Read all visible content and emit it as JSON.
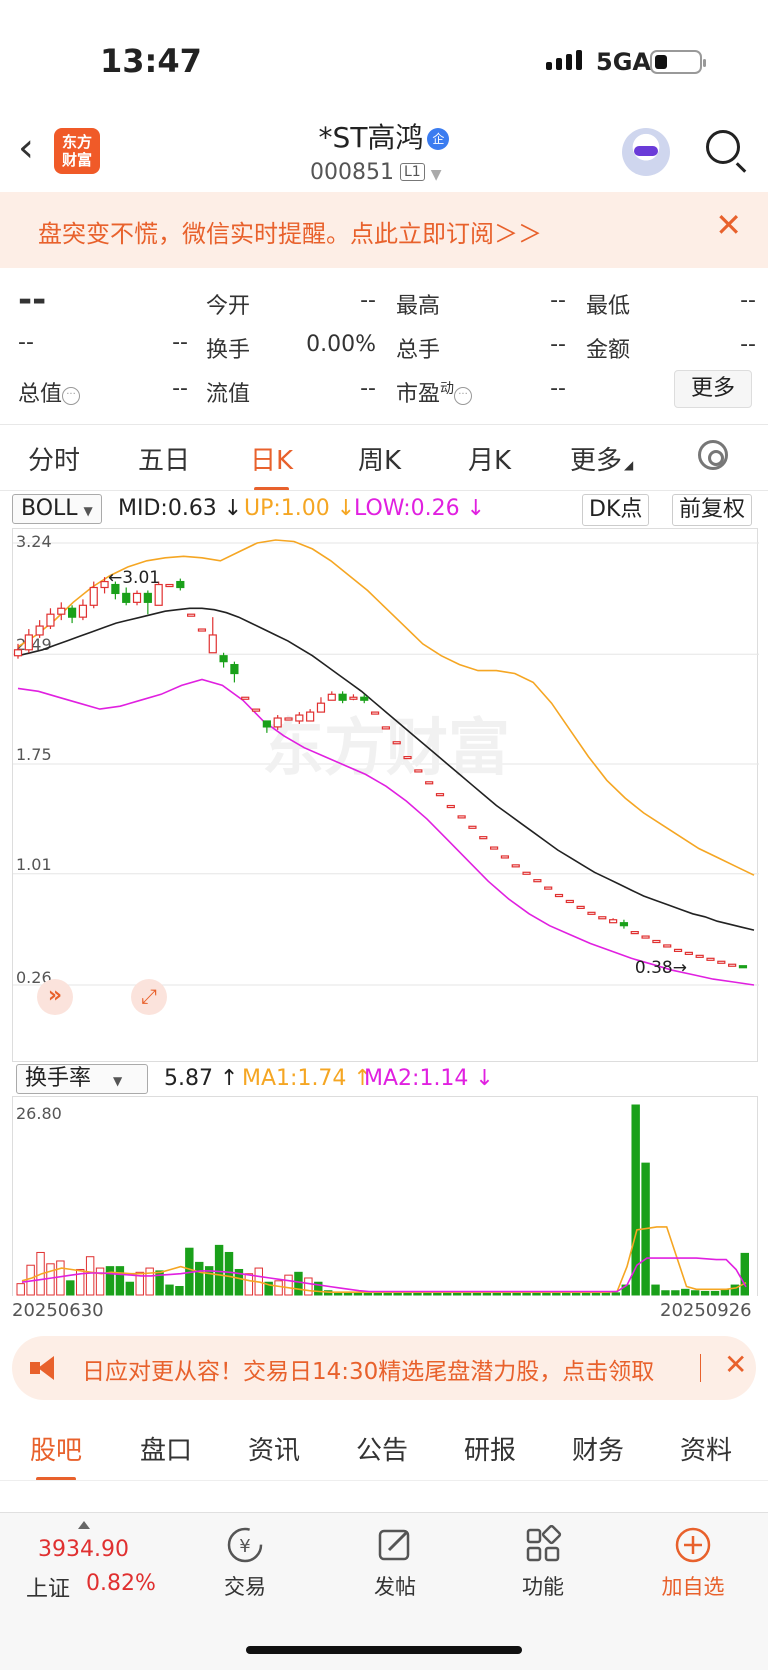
{
  "status_bar": {
    "time": "13:47",
    "network": "5GA"
  },
  "header": {
    "title": "*ST高鸿",
    "badge": "企",
    "code": "000851",
    "level": "L1",
    "logo_text": "东方财富"
  },
  "banner": {
    "text": "盘突变不慌，微信实时提醒。点此立即订阅＞＞"
  },
  "quote": {
    "price": "--",
    "change": "--",
    "change_pct": "--",
    "open_label": "今开",
    "open": "--",
    "high_label": "最高",
    "high": "--",
    "low_label": "最低",
    "low": "--",
    "turnover_label": "换手",
    "turnover": "0.00%",
    "volume_label": "总手",
    "volume": "--",
    "amount_label": "金额",
    "amount": "--",
    "mktcap_label": "总值",
    "mktcap": "--",
    "float_label": "流值",
    "float": "--",
    "pe_label": "市盈",
    "pe_sup": "动",
    "pe": "--",
    "more": "更多"
  },
  "tabs": [
    "分时",
    "五日",
    "日K",
    "周K",
    "月K",
    "更多"
  ],
  "active_tab": "日K",
  "indicator": {
    "select": "BOLL",
    "mid": "MID:0.63",
    "up": "UP:1.00",
    "low": "LOW:0.26",
    "dk": "DK点",
    "adjust": "前复权"
  },
  "volume_indicator": {
    "select": "换手率",
    "value": "5.87",
    "ma1": "MA1:1.74",
    "ma2": "MA2:1.14"
  },
  "dates": {
    "start": "20250630",
    "end": "20250926"
  },
  "colors": {
    "up": "#e03030",
    "down": "#1aa01a",
    "mid": "#222222",
    "upper": "#f5a623",
    "lower": "#e020e0",
    "accent": "#e8612c"
  },
  "chart_data": [
    {
      "type": "candlestick",
      "watermark": "东方财富",
      "y_ticks": [
        "3.24",
        "2.49",
        "1.75",
        "1.01",
        "0.26"
      ],
      "ylim": [
        0.26,
        3.24
      ],
      "annotations": {
        "high_mark": "3.01",
        "last_mark": "0.38"
      },
      "candles": [
        [
          2.48,
          2.52,
          2.56,
          2.46
        ],
        [
          2.52,
          2.62,
          2.66,
          2.5
        ],
        [
          2.62,
          2.68,
          2.72,
          2.6
        ],
        [
          2.68,
          2.76,
          2.8,
          2.66
        ],
        [
          2.76,
          2.8,
          2.84,
          2.72
        ],
        [
          2.8,
          2.74,
          2.82,
          2.7
        ],
        [
          2.74,
          2.82,
          2.86,
          2.72
        ],
        [
          2.82,
          2.94,
          2.98,
          2.8
        ],
        [
          2.94,
          2.98,
          3.01,
          2.9
        ],
        [
          2.96,
          2.9,
          2.98,
          2.86
        ],
        [
          2.9,
          2.84,
          2.94,
          2.82
        ],
        [
          2.84,
          2.9,
          2.92,
          2.82
        ],
        [
          2.9,
          2.84,
          2.92,
          2.76
        ],
        [
          2.82,
          2.96,
          2.98,
          2.82
        ],
        [
          2.96,
          2.96,
          2.96,
          2.96
        ],
        [
          2.98,
          2.94,
          3.0,
          2.92
        ],
        [
          2.76,
          2.76,
          2.76,
          2.76
        ],
        [
          2.66,
          2.66,
          2.66,
          2.66
        ],
        [
          2.5,
          2.62,
          2.74,
          2.5
        ],
        [
          2.48,
          2.44,
          2.5,
          2.4
        ],
        [
          2.42,
          2.36,
          2.44,
          2.3
        ],
        [
          2.2,
          2.2,
          2.2,
          2.2
        ],
        [
          2.12,
          2.12,
          2.12,
          2.12
        ],
        [
          2.04,
          2.0,
          2.04,
          1.96
        ],
        [
          2.0,
          2.06,
          2.08,
          1.98
        ],
        [
          2.06,
          2.06,
          2.06,
          2.06
        ],
        [
          2.04,
          2.08,
          2.1,
          2.02
        ],
        [
          2.04,
          2.1,
          2.12,
          2.04
        ],
        [
          2.1,
          2.16,
          2.2,
          2.1
        ],
        [
          2.18,
          2.22,
          2.24,
          2.18
        ],
        [
          2.22,
          2.18,
          2.24,
          2.16
        ],
        [
          2.2,
          2.2,
          2.22,
          2.18
        ],
        [
          2.2,
          2.18,
          2.22,
          2.16
        ],
        [
          2.1,
          2.1,
          2.1,
          2.1
        ],
        [
          2.0,
          2.0,
          2.0,
          2.0
        ],
        [
          1.9,
          1.9,
          1.9,
          1.9
        ],
        [
          1.8,
          1.8,
          1.8,
          1.8
        ],
        [
          1.71,
          1.71,
          1.71,
          1.71
        ],
        [
          1.63,
          1.63,
          1.63,
          1.63
        ],
        [
          1.55,
          1.55,
          1.55,
          1.55
        ],
        [
          1.47,
          1.47,
          1.47,
          1.47
        ],
        [
          1.4,
          1.4,
          1.4,
          1.4
        ],
        [
          1.33,
          1.33,
          1.33,
          1.33
        ],
        [
          1.26,
          1.26,
          1.26,
          1.26
        ],
        [
          1.19,
          1.19,
          1.19,
          1.19
        ],
        [
          1.13,
          1.13,
          1.13,
          1.13
        ],
        [
          1.07,
          1.07,
          1.07,
          1.07
        ],
        [
          1.02,
          1.02,
          1.02,
          1.02
        ],
        [
          0.97,
          0.97,
          0.97,
          0.97
        ],
        [
          0.92,
          0.92,
          0.92,
          0.92
        ],
        [
          0.87,
          0.87,
          0.87,
          0.87
        ],
        [
          0.83,
          0.83,
          0.83,
          0.83
        ],
        [
          0.79,
          0.79,
          0.79,
          0.79
        ],
        [
          0.75,
          0.75,
          0.75,
          0.75
        ],
        [
          0.72,
          0.72,
          0.72,
          0.72
        ],
        [
          0.68,
          0.7,
          0.71,
          0.68
        ],
        [
          0.68,
          0.66,
          0.7,
          0.64
        ],
        [
          0.62,
          0.62,
          0.62,
          0.62
        ],
        [
          0.59,
          0.59,
          0.59,
          0.59
        ],
        [
          0.56,
          0.56,
          0.56,
          0.56
        ],
        [
          0.53,
          0.53,
          0.53,
          0.53
        ],
        [
          0.5,
          0.5,
          0.5,
          0.5
        ],
        [
          0.48,
          0.48,
          0.48,
          0.48
        ],
        [
          0.46,
          0.46,
          0.46,
          0.46
        ],
        [
          0.44,
          0.44,
          0.44,
          0.44
        ],
        [
          0.42,
          0.42,
          0.42,
          0.42
        ],
        [
          0.4,
          0.4,
          0.4,
          0.4
        ],
        [
          0.39,
          0.38,
          0.39,
          0.38
        ]
      ],
      "mid": [
        2.48,
        2.5,
        2.52,
        2.55,
        2.58,
        2.61,
        2.64,
        2.67,
        2.7,
        2.72,
        2.74,
        2.76,
        2.78,
        2.79,
        2.8,
        2.8,
        2.79,
        2.77,
        2.74,
        2.7,
        2.66,
        2.62,
        2.58,
        2.53,
        2.48,
        2.42,
        2.36,
        2.3,
        2.24,
        2.17,
        2.1,
        2.03,
        1.96,
        1.89,
        1.82,
        1.75,
        1.68,
        1.61,
        1.54,
        1.47,
        1.41,
        1.35,
        1.29,
        1.23,
        1.17,
        1.12,
        1.07,
        1.02,
        0.98,
        0.94,
        0.9,
        0.86,
        0.83,
        0.8,
        0.77,
        0.74,
        0.72,
        0.69,
        0.67,
        0.65,
        0.63
      ],
      "upper": [
        2.54,
        2.62,
        2.72,
        2.84,
        2.94,
        3.02,
        3.08,
        3.12,
        3.14,
        3.15,
        3.14,
        3.12,
        3.18,
        3.24,
        3.26,
        3.25,
        3.2,
        3.12,
        3.02,
        2.92,
        2.8,
        2.68,
        2.56,
        2.48,
        2.42,
        2.38,
        2.38,
        2.36,
        2.3,
        2.16,
        1.98,
        1.8,
        1.64,
        1.52,
        1.42,
        1.34,
        1.26,
        1.18,
        1.12,
        1.06,
        1.0
      ],
      "lower": [
        2.26,
        2.24,
        2.2,
        2.16,
        2.12,
        2.14,
        2.18,
        2.22,
        2.28,
        2.32,
        2.28,
        2.18,
        2.04,
        1.94,
        1.86,
        1.8,
        1.74,
        1.68,
        1.6,
        1.5,
        1.38,
        1.24,
        1.1,
        0.96,
        0.84,
        0.74,
        0.66,
        0.6,
        0.54,
        0.49,
        0.44,
        0.4,
        0.36,
        0.33,
        0.3,
        0.28,
        0.26
      ],
      "series_names": [
        "MID",
        "UP",
        "LOW"
      ]
    },
    {
      "type": "bar",
      "y_ticks": [
        "26.80"
      ],
      "ylim": [
        0,
        26.8
      ],
      "values": [
        1.6,
        4.2,
        6.0,
        4.4,
        4.8,
        2.0,
        3.6,
        5.4,
        3.8,
        4.0,
        4.0,
        1.8,
        3.2,
        3.8,
        3.4,
        1.4,
        1.2,
        6.6,
        4.6,
        4.0,
        7.0,
        6.0,
        3.6,
        3.0,
        3.8,
        1.8,
        2.0,
        2.8,
        3.2,
        2.4,
        1.8,
        0.6,
        0.4,
        0.4,
        0.3,
        0.3,
        0.3,
        0.3,
        0.3,
        0.3,
        0.3,
        0.3,
        0.3,
        0.3,
        0.3,
        0.3,
        0.3,
        0.3,
        0.3,
        0.3,
        0.3,
        0.3,
        0.3,
        0.3,
        0.3,
        0.3,
        0.3,
        0.3,
        0.3,
        0.3,
        0.3,
        1.4,
        26.8,
        18.6,
        1.4,
        0.6,
        0.6,
        0.8,
        0.6,
        0.5,
        0.5,
        0.8,
        1.4,
        5.87
      ],
      "up_flags": [
        1,
        1,
        1,
        1,
        1,
        0,
        1,
        1,
        1,
        0,
        0,
        0,
        1,
        1,
        0,
        0,
        0,
        0,
        0,
        0,
        0,
        0,
        0,
        1,
        1,
        0,
        1,
        1,
        0,
        1,
        0,
        0,
        0,
        0,
        0,
        0,
        0,
        0,
        0,
        0,
        0,
        0,
        0,
        0,
        0,
        0,
        0,
        0,
        0,
        0,
        0,
        0,
        0,
        0,
        0,
        0,
        0,
        0,
        0,
        0,
        0,
        0,
        0,
        0,
        0,
        0,
        0,
        0,
        0,
        0,
        0,
        0,
        0,
        0
      ],
      "ma1": [
        2.0,
        2.4,
        3.0,
        3.4,
        3.8,
        3.6,
        3.4,
        3.2,
        3.0,
        3.2,
        3.1,
        3.0,
        3.0,
        3.1,
        3.2,
        3.6,
        4.0,
        3.6,
        3.2,
        3.0,
        2.8,
        2.6,
        2.3,
        2.0,
        1.8,
        1.4,
        1.2,
        1.0,
        0.8,
        0.6,
        0.5,
        0.4,
        0.4,
        0.4,
        0.4,
        0.4,
        0.4,
        0.4,
        0.4,
        0.4,
        0.4,
        0.4,
        0.4,
        0.4,
        0.4,
        0.4,
        0.4,
        0.4,
        0.4,
        0.4,
        0.4,
        0.4,
        0.4,
        0.4,
        0.4,
        0.4,
        0.4,
        0.4,
        0.4,
        0.4,
        0.5,
        4.0,
        9.2,
        9.4,
        9.6,
        9.6,
        5.4,
        1.2,
        0.8,
        0.8,
        0.8,
        0.8,
        1.0,
        1.74
      ],
      "ma2": [
        1.8,
        2.0,
        2.2,
        2.4,
        2.6,
        2.8,
        3.0,
        3.1,
        3.1,
        3.0,
        2.9,
        2.8,
        2.7,
        2.7,
        2.8,
        2.9,
        3.0,
        3.2,
        3.4,
        3.4,
        3.3,
        3.2,
        3.0,
        2.8,
        2.6,
        2.4,
        2.2,
        2.0,
        1.8,
        1.6,
        1.4,
        1.2,
        1.0,
        0.8,
        0.6,
        0.5,
        0.5,
        0.5,
        0.5,
        0.5,
        0.5,
        0.5,
        0.5,
        0.5,
        0.5,
        0.5,
        0.5,
        0.5,
        0.5,
        0.5,
        0.5,
        0.5,
        0.5,
        0.5,
        0.5,
        0.5,
        0.5,
        0.5,
        0.5,
        0.5,
        0.5,
        1.4,
        4.2,
        5.2,
        5.2,
        5.2,
        5.2,
        5.2,
        5.2,
        5.1,
        5.0,
        5.0,
        3.6,
        1.14
      ],
      "series_names": [
        "换手率",
        "MA1",
        "MA2"
      ]
    }
  ],
  "banner2": {
    "text": "日应对更从容！交易日14:30精选尾盘潜力股，点击领取"
  },
  "bottom_tabs": [
    "股吧",
    "盘口",
    "资讯",
    "公告",
    "研报",
    "财务",
    "资料"
  ],
  "bottom_tabs_active": "股吧",
  "bottom_bar": {
    "index_value": "3934.90",
    "index_name": "上证",
    "index_change": "0.82%",
    "items": [
      "交易",
      "发帖",
      "功能",
      "加自选"
    ]
  }
}
